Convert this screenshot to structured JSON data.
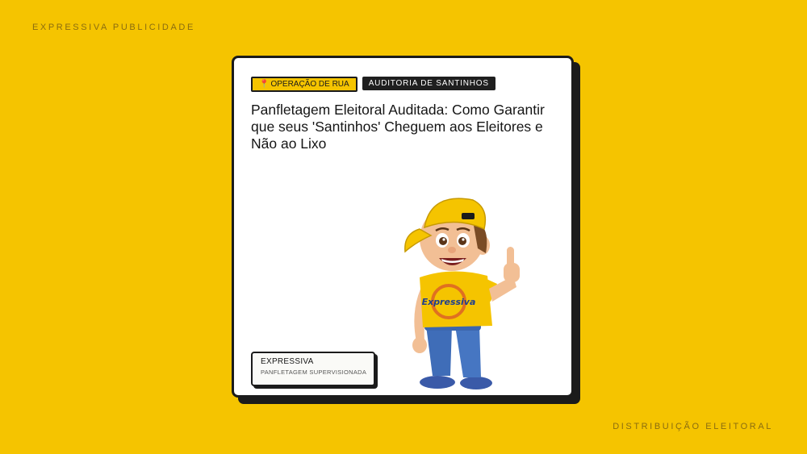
{
  "corner": {
    "top_left": "EXPRESSIVA PUBLICIDADE",
    "bottom_right": "DISTRIBUIÇÃO ELEITORAL"
  },
  "card": {
    "tags": [
      {
        "label": "OPERAÇÃO DE RUA",
        "icon": "pin-icon"
      },
      {
        "label": "AUDITORIA DE SANTINHOS"
      }
    ],
    "headline": "Panfletagem Eleitoral Auditada: Como Garantir que seus 'Santinhos' Cheguem aos Eleitores e Não ao Lixo",
    "brand_box": {
      "name": "EXPRESSIVA",
      "subtitle": "PANFLETAGEM SUPERVISIONADA"
    },
    "mascot_shirt_text": "Expressiva"
  },
  "colors": {
    "background": "#F5C400",
    "dark": "#1b1b1b",
    "card": "#ffffff"
  }
}
